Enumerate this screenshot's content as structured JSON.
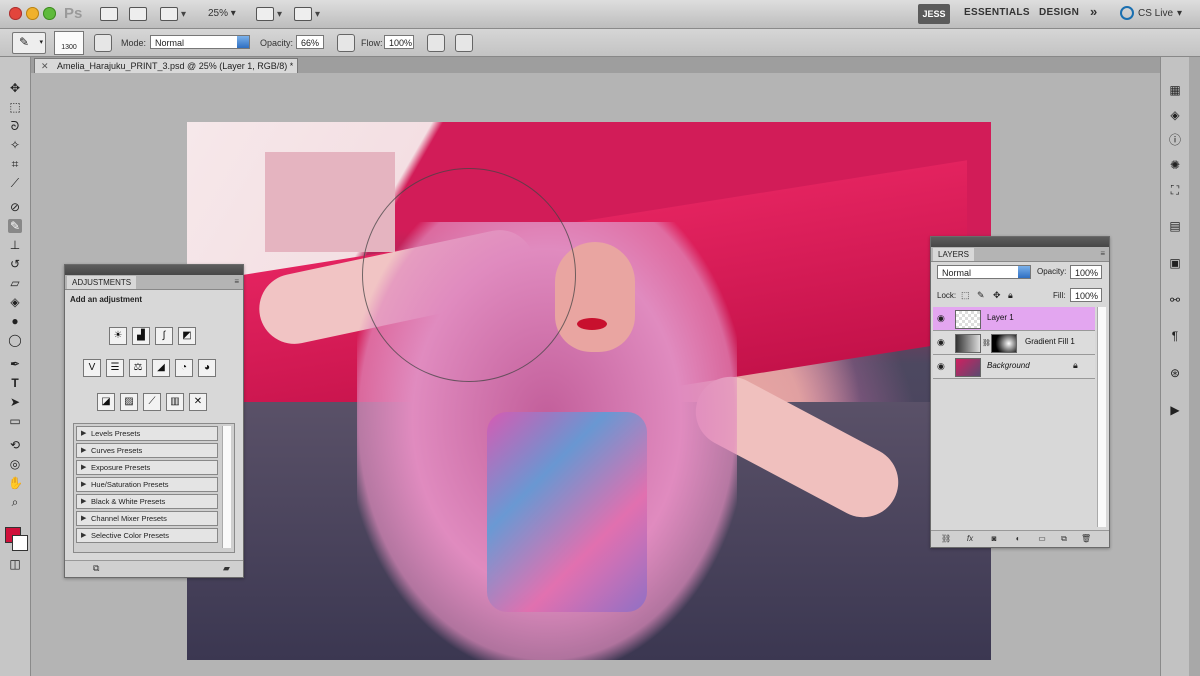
{
  "app": {
    "logo": "Ps",
    "zoom": "25%",
    "workspace_active": "JESS",
    "workspaces": [
      "ESSENTIALS",
      "DESIGN"
    ],
    "more": "»",
    "cs_live": "CS Live"
  },
  "options": {
    "brush_size": "1300",
    "mode_label": "Mode:",
    "mode_value": "Normal",
    "opacity_label": "Opacity:",
    "opacity_value": "66%",
    "flow_label": "Flow:",
    "flow_value": "100%"
  },
  "document": {
    "tab_title": "Amelia_Harajuku_PRINT_3.psd @ 25% (Layer 1, RGB/8) *"
  },
  "colors": {
    "foreground": "#d0103a",
    "background": "#ffffff",
    "selected_layer": "#e3a6f0"
  },
  "adjustments": {
    "tab": "ADJUSTMENTS",
    "title": "Add an adjustment",
    "icons_row1": [
      "brightness-contrast-icon",
      "levels-icon",
      "curves-icon",
      "exposure-icon"
    ],
    "icons_row2": [
      "vibrance-icon",
      "hue-saturation-icon",
      "color-balance-icon",
      "black-white-icon",
      "photo-filter-icon",
      "channel-mixer-icon"
    ],
    "icons_row3": [
      "invert-icon",
      "posterize-icon",
      "threshold-icon",
      "gradient-map-icon",
      "selective-color-icon"
    ],
    "presets": [
      "Levels Presets",
      "Curves Presets",
      "Exposure Presets",
      "Hue/Saturation Presets",
      "Black & White Presets",
      "Channel Mixer Presets",
      "Selective Color Presets"
    ]
  },
  "layers": {
    "tab": "LAYERS",
    "blend_mode": "Normal",
    "opacity_label": "Opacity:",
    "opacity_value": "100%",
    "lock_label": "Lock:",
    "fill_label": "Fill:",
    "fill_value": "100%",
    "items": [
      {
        "name": "Layer 1",
        "selected": true
      },
      {
        "name": "Gradient Fill 1",
        "selected": false
      },
      {
        "name": "Background",
        "selected": false
      }
    ]
  }
}
